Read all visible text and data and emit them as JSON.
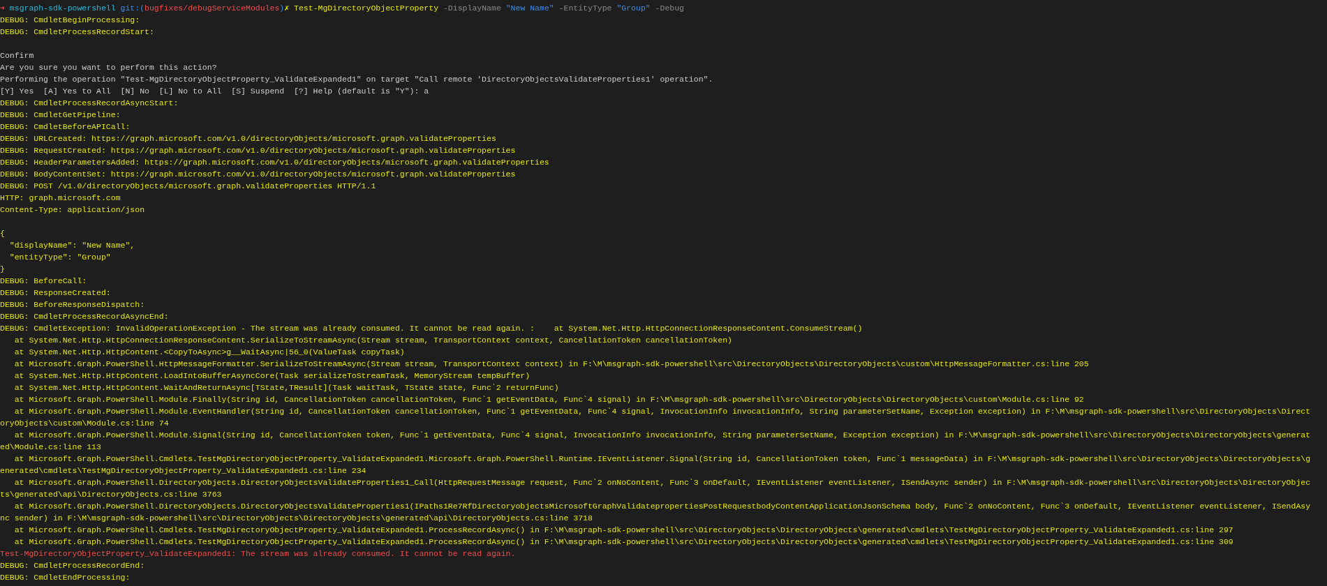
{
  "terminal": {
    "lines": [
      {
        "kind": "prompt",
        "segments": [
          {
            "kind": "arrow",
            "text": "➜"
          },
          {
            "kind": "directory",
            "text": "msgraph-sdk-powershell"
          },
          {
            "kind": "git",
            "text": "git:("
          },
          {
            "kind": "branch",
            "text": "bugfixes/debugServiceModules"
          },
          {
            "kind": "git",
            "text": ")"
          },
          {
            "kind": "dirty",
            "text": "✗"
          },
          {
            "kind": "command",
            "text": "Test-MgDirectoryObjectProperty"
          },
          {
            "kind": "param",
            "text": "-DisplayName"
          },
          {
            "kind": "string",
            "text": "\"New Name\""
          },
          {
            "kind": "param",
            "text": "-EntityType"
          },
          {
            "kind": "string",
            "text": "\"Group\""
          },
          {
            "kind": "param",
            "text": "-Debug"
          }
        ]
      },
      {
        "kind": "debug",
        "text": "DEBUG: CmdletBeginProcessing:"
      },
      {
        "kind": "debug",
        "text": "DEBUG: CmdletProcessRecordStart:"
      },
      {
        "kind": "blank"
      },
      {
        "kind": "plain",
        "text": "Confirm"
      },
      {
        "kind": "plain",
        "text": "Are you sure you want to perform this action?"
      },
      {
        "kind": "plain",
        "text": "Performing the operation \"Test-MgDirectoryObjectProperty_ValidateExpanded1\" on target \"Call remote 'DirectoryObjectsValidateProperties1' operation\"."
      },
      {
        "kind": "plain",
        "text": "[Y] Yes  [A] Yes to All  [N] No  [L] No to All  [S] Suspend  [?] Help (default is \"Y\"): a"
      },
      {
        "kind": "debug",
        "text": "DEBUG: CmdletProcessRecordAsyncStart:"
      },
      {
        "kind": "debug",
        "text": "DEBUG: CmdletGetPipeline:"
      },
      {
        "kind": "debug",
        "text": "DEBUG: CmdletBeforeAPICall:"
      },
      {
        "kind": "debug",
        "text": "DEBUG: URLCreated: https://graph.microsoft.com/v1.0/directoryObjects/microsoft.graph.validateProperties"
      },
      {
        "kind": "debug",
        "text": "DEBUG: RequestCreated: https://graph.microsoft.com/v1.0/directoryObjects/microsoft.graph.validateProperties"
      },
      {
        "kind": "debug",
        "text": "DEBUG: HeaderParametersAdded: https://graph.microsoft.com/v1.0/directoryObjects/microsoft.graph.validateProperties"
      },
      {
        "kind": "debug",
        "text": "DEBUG: BodyContentSet: https://graph.microsoft.com/v1.0/directoryObjects/microsoft.graph.validateProperties"
      },
      {
        "kind": "debug",
        "text": "DEBUG: POST /v1.0/directoryObjects/microsoft.graph.validateProperties HTTP/1.1"
      },
      {
        "kind": "debug",
        "text": "HTTP: graph.microsoft.com"
      },
      {
        "kind": "debug",
        "text": "Content-Type: application/json"
      },
      {
        "kind": "blank"
      },
      {
        "kind": "debug",
        "text": "{"
      },
      {
        "kind": "debug",
        "text": "  \"displayName\": \"New Name\","
      },
      {
        "kind": "debug",
        "text": "  \"entityType\": \"Group\""
      },
      {
        "kind": "debug",
        "text": "}"
      },
      {
        "kind": "debug",
        "text": "DEBUG: BeforeCall:"
      },
      {
        "kind": "debug",
        "text": "DEBUG: ResponseCreated:"
      },
      {
        "kind": "debug",
        "text": "DEBUG: BeforeResponseDispatch:"
      },
      {
        "kind": "debug",
        "text": "DEBUG: CmdletProcessRecordAsyncEnd:"
      },
      {
        "kind": "debug",
        "text": "DEBUG: CmdletException: InvalidOperationException - The stream was already consumed. It cannot be read again. :    at System.Net.Http.HttpConnectionResponseContent.ConsumeStream()"
      },
      {
        "kind": "debug",
        "text": "   at System.Net.Http.HttpConnectionResponseContent.SerializeToStreamAsync(Stream stream, TransportContext context, CancellationToken cancellationToken)"
      },
      {
        "kind": "debug",
        "text": "   at System.Net.Http.HttpContent.<CopyToAsync>g__WaitAsync|56_0(ValueTask copyTask)"
      },
      {
        "kind": "debug",
        "text": "   at Microsoft.Graph.PowerShell.HttpMessageFormatter.SerializeToStreamAsync(Stream stream, TransportContext context) in F:\\M\\msgraph-sdk-powershell\\src\\DirectoryObjects\\DirectoryObjects\\custom\\HttpMessageFormatter.cs:line 205"
      },
      {
        "kind": "debug",
        "text": "   at System.Net.Http.HttpContent.LoadIntoBufferAsyncCore(Task serializeToStreamTask, MemoryStream tempBuffer)"
      },
      {
        "kind": "debug",
        "text": "   at System.Net.Http.HttpContent.WaitAndReturnAsync[TState,TResult](Task waitTask, TState state, Func`2 returnFunc)"
      },
      {
        "kind": "debug",
        "text": "   at Microsoft.Graph.PowerShell.Module.Finally(String id, CancellationToken cancellationToken, Func`1 getEventData, Func`4 signal) in F:\\M\\msgraph-sdk-powershell\\src\\DirectoryObjects\\DirectoryObjects\\custom\\Module.cs:line 92"
      },
      {
        "kind": "debug",
        "text": "   at Microsoft.Graph.PowerShell.Module.EventHandler(String id, CancellationToken cancellationToken, Func`1 getEventData, Func`4 signal, InvocationInfo invocationInfo, String parameterSetName, Exception exception) in F:\\M\\msgraph-sdk-powershell\\src\\DirectoryObjects\\Direct"
      },
      {
        "kind": "debug",
        "text": "oryObjects\\custom\\Module.cs:line 74"
      },
      {
        "kind": "debug",
        "text": "   at Microsoft.Graph.PowerShell.Module.Signal(String id, CancellationToken token, Func`1 getEventData, Func`4 signal, InvocationInfo invocationInfo, String parameterSetName, Exception exception) in F:\\M\\msgraph-sdk-powershell\\src\\DirectoryObjects\\DirectoryObjects\\generat"
      },
      {
        "kind": "debug",
        "text": "ed\\Module.cs:line 113"
      },
      {
        "kind": "debug",
        "text": "   at Microsoft.Graph.PowerShell.Cmdlets.TestMgDirectoryObjectProperty_ValidateExpanded1.Microsoft.Graph.PowerShell.Runtime.IEventListener.Signal(String id, CancellationToken token, Func`1 messageData) in F:\\M\\msgraph-sdk-powershell\\src\\DirectoryObjects\\DirectoryObjects\\g"
      },
      {
        "kind": "debug",
        "text": "enerated\\cmdlets\\TestMgDirectoryObjectProperty_ValidateExpanded1.cs:line 234"
      },
      {
        "kind": "debug",
        "text": "   at Microsoft.Graph.PowerShell.DirectoryObjects.DirectoryObjectsValidateProperties1_Call(HttpRequestMessage request, Func`2 onNoContent, Func`3 onDefault, IEventListener eventListener, ISendAsync sender) in F:\\M\\msgraph-sdk-powershell\\src\\DirectoryObjects\\DirectoryObjec"
      },
      {
        "kind": "debug",
        "text": "ts\\generated\\api\\DirectoryObjects.cs:line 3763"
      },
      {
        "kind": "debug",
        "text": "   at Microsoft.Graph.PowerShell.DirectoryObjects.DirectoryObjectsValidateProperties1(IPaths1Re7RfDirectoryobjectsMicrosoftGraphValidatepropertiesPostRequestbodyContentApplicationJsonSchema body, Func`2 onNoContent, Func`3 onDefault, IEventListener eventListener, ISendAsy"
      },
      {
        "kind": "debug",
        "text": "nc sender) in F:\\M\\msgraph-sdk-powershell\\src\\DirectoryObjects\\DirectoryObjects\\generated\\api\\DirectoryObjects.cs:line 3718"
      },
      {
        "kind": "debug",
        "text": "   at Microsoft.Graph.PowerShell.Cmdlets.TestMgDirectoryObjectProperty_ValidateExpanded1.ProcessRecordAsync() in F:\\M\\msgraph-sdk-powershell\\src\\DirectoryObjects\\DirectoryObjects\\generated\\cmdlets\\TestMgDirectoryObjectProperty_ValidateExpanded1.cs:line 297"
      },
      {
        "kind": "debug",
        "text": "   at Microsoft.Graph.PowerShell.Cmdlets.TestMgDirectoryObjectProperty_ValidateExpanded1.ProcessRecordAsync() in F:\\M\\msgraph-sdk-powershell\\src\\DirectoryObjects\\DirectoryObjects\\generated\\cmdlets\\TestMgDirectoryObjectProperty_ValidateExpanded1.cs:line 309"
      },
      {
        "kind": "error",
        "text": "Test-MgDirectoryObjectProperty_ValidateExpanded1: The stream was already consumed. It cannot be read again."
      },
      {
        "kind": "debug",
        "text": "DEBUG: CmdletProcessRecordEnd:"
      },
      {
        "kind": "debug",
        "text": "DEBUG: CmdletEndProcessing:"
      }
    ]
  }
}
